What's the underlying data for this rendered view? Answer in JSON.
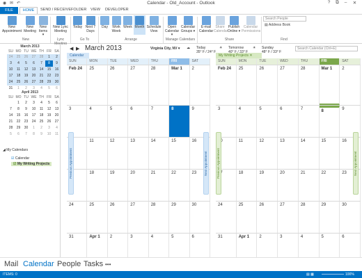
{
  "titlebar": {
    "title": "Calendar - Old_Account - Outlook",
    "qa_send": "✉",
    "qa_undo": "↶",
    "min": "–",
    "max": "□",
    "close": "✕",
    "help": "?",
    "restore": "⧉"
  },
  "ribbon_tabs": {
    "file": "FILE",
    "home": "HOME",
    "send_receive": "SEND / RECEIVE",
    "folder": "FOLDER",
    "view": "VIEW",
    "developer": "DEVELOPER"
  },
  "ribbon": {
    "new_appointment": "New Appointment",
    "new_meeting": "New Meeting",
    "new_items": "New Items ▾",
    "new_lync": "New Lync Meeting",
    "today": "Today",
    "next7": "Next 7 Days",
    "day": "Day",
    "work_week": "Work Week",
    "week": "Week",
    "month": "Month",
    "schedule_view": "Schedule View",
    "open_calendar": "Open Calendar ▾",
    "calendar_groups": "Calendar Groups ▾",
    "email_calendar": "E-mail Calendar",
    "share_calendar": "Share Calendar",
    "publish_online": "Publish Online ▾",
    "calendar_permissions": "Calendar Permissions",
    "search_people": "Search People",
    "address_book": "Address Book",
    "groups": {
      "new": "New",
      "lync": "Lync Meeting",
      "goto": "Go To",
      "arrange": "Arrange",
      "manage": "Manage Calendars",
      "share": "Share",
      "find": "Find"
    }
  },
  "nav": {
    "march": {
      "title": "March 2013",
      "dows": [
        "SU",
        "MO",
        "TU",
        "WE",
        "TH",
        "FR",
        "SA"
      ],
      "rows": [
        [
          "24",
          "25",
          "26",
          "27",
          "28",
          "1",
          "2"
        ],
        [
          "3",
          "4",
          "5",
          "6",
          "7",
          "8",
          "9"
        ],
        [
          "10",
          "11",
          "12",
          "13",
          "14",
          "15",
          "16"
        ],
        [
          "17",
          "18",
          "19",
          "20",
          "21",
          "22",
          "23"
        ],
        [
          "24",
          "25",
          "26",
          "27",
          "28",
          "29",
          "30"
        ],
        [
          "31",
          "1",
          "2",
          "3",
          "4",
          "5",
          "6"
        ]
      ]
    },
    "april": {
      "title": "April 2013",
      "dows": [
        "SU",
        "MO",
        "TU",
        "WE",
        "TH",
        "FR",
        "SA"
      ],
      "rows": [
        [
          "",
          "1",
          "2",
          "3",
          "4",
          "5",
          "6"
        ],
        [
          "7",
          "8",
          "9",
          "10",
          "11",
          "12",
          "13"
        ],
        [
          "14",
          "15",
          "16",
          "17",
          "18",
          "19",
          "20"
        ],
        [
          "21",
          "22",
          "23",
          "24",
          "25",
          "26",
          "27"
        ],
        [
          "28",
          "29",
          "30",
          "1",
          "2",
          "3",
          "4"
        ],
        [
          "5",
          "6",
          "7",
          "8",
          "9",
          "10",
          "11"
        ]
      ]
    },
    "my_calendars": "My Calendars",
    "calendar": "Calendar",
    "writing_projects": "My Writing Projects"
  },
  "infobar": {
    "month_title": "March 2013",
    "location": "Virginia City, NV ▾",
    "w1_label": "Today",
    "w1_temp": "35° F / 24° F",
    "w2_label": "Tomorrow",
    "w2_temp": "40° F / 33° F",
    "w3_label": "Sunday",
    "w3_temp": "48° F / 33° F",
    "search_cal": "Search Calendar (Ctrl+E)"
  },
  "cal1": {
    "tab": "Calendar",
    "prev": "Previous Appointment",
    "next": "Next Appointment",
    "dows": [
      "SUN",
      "MON",
      "TUE",
      "WED",
      "THU",
      "FRI",
      "SAT"
    ],
    "weeks": [
      [
        "Feb 24",
        "25",
        "26",
        "27",
        "28",
        "Mar 1",
        "2"
      ],
      [
        "3",
        "4",
        "5",
        "6",
        "7",
        "8",
        "9"
      ],
      [
        "10",
        "11",
        "12",
        "13",
        "14",
        "15",
        "16"
      ],
      [
        "17",
        "18",
        "19",
        "20",
        "21",
        "22",
        "23"
      ],
      [
        "24",
        "25",
        "26",
        "27",
        "28",
        "29",
        "30"
      ],
      [
        "31",
        "Apr 1",
        "2",
        "3",
        "4",
        "5",
        "6"
      ]
    ]
  },
  "cal2": {
    "tab": "My Writing Projects",
    "close": "✕",
    "prev": "Previous Appointment",
    "next": "Next Appointment",
    "dows": [
      "SUN",
      "MON",
      "TUE",
      "WED",
      "THU",
      "FRI",
      "SAT"
    ],
    "weeks": [
      [
        "Feb 24",
        "25",
        "26",
        "27",
        "28",
        "Mar 1",
        "2"
      ],
      [
        "3",
        "4",
        "5",
        "6",
        "7",
        "8",
        "9"
      ],
      [
        "10",
        "11",
        "12",
        "13",
        "14",
        "15",
        "16"
      ],
      [
        "17",
        "18",
        "19",
        "20",
        "21",
        "22",
        "23"
      ],
      [
        "24",
        "25",
        "26",
        "27",
        "28",
        "29",
        "30"
      ],
      [
        "31",
        "Apr 1",
        "2",
        "3",
        "4",
        "5",
        "6"
      ]
    ]
  },
  "bottomnav": {
    "mail": "Mail",
    "calendar": "Calendar",
    "people": "People",
    "tasks": "Tasks",
    "more": "•••"
  },
  "status": {
    "items": "ITEMS: 0",
    "zoom": "100%"
  },
  "colors": {
    "accent": "#0072c6",
    "green": "#7ba74b"
  }
}
